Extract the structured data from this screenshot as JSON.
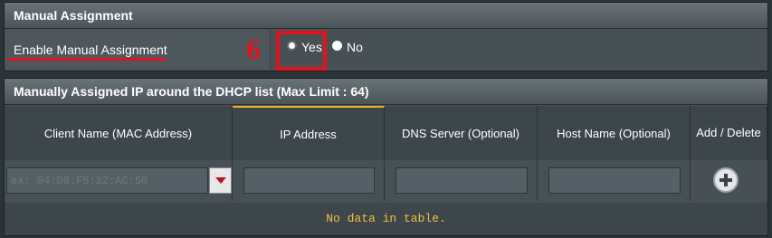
{
  "manual_section": {
    "title": "Manual Assignment",
    "enable_label": "Enable Manual Assignment",
    "step_number": "6",
    "yes_label": "Yes",
    "no_label": "No",
    "selected": "Yes"
  },
  "assigned_section": {
    "title": "Manually Assigned IP around the DHCP list (Max Limit : 64)",
    "columns": [
      "Client Name (MAC Address)",
      "IP Address",
      "DNS Server (Optional)",
      "Host Name (Optional)",
      "Add / Delete"
    ],
    "mac_placeholder": "ex: 04:D9:F5:22:AC:50",
    "ip_value": "",
    "dns_value": "",
    "host_value": "",
    "no_data_text": "No data in table."
  },
  "colors": {
    "annotation_red": "#e0141c",
    "no_data_yellow": "#f0c040",
    "active_column_accent": "#f0b020"
  },
  "icons": [
    "chevron-down-icon",
    "plus-circle-icon"
  ]
}
